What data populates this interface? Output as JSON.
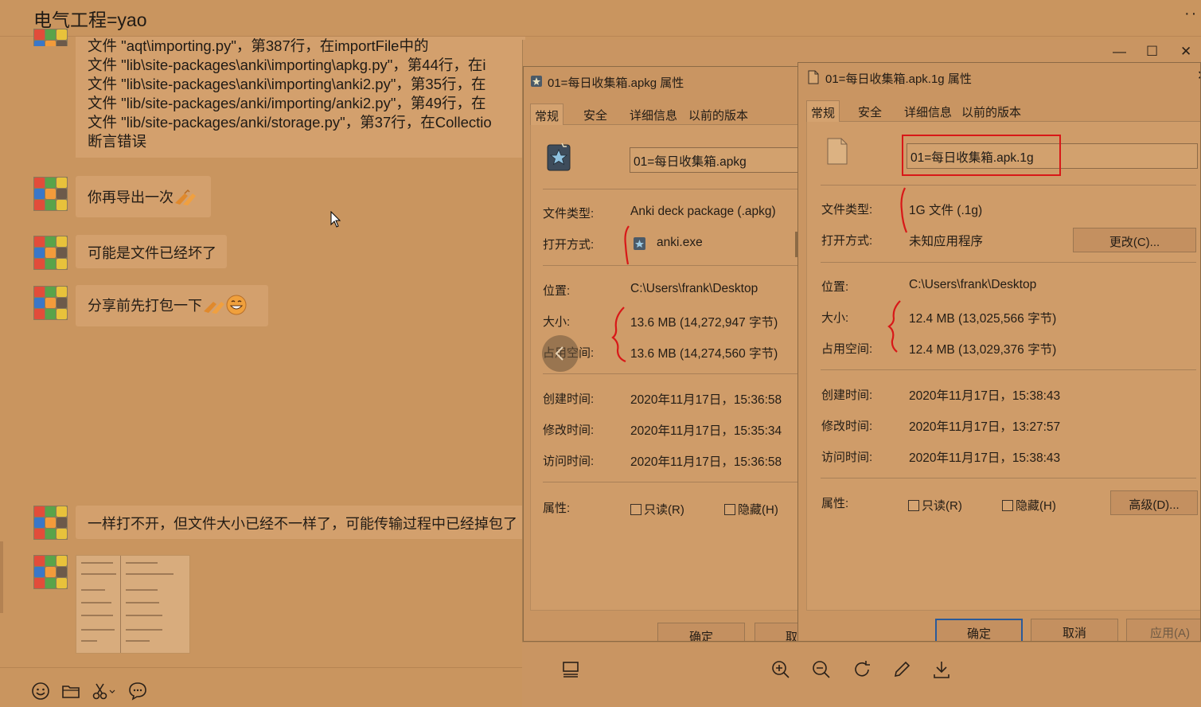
{
  "chat": {
    "title": "电气工程=yao",
    "more_icon": "more-dots-icon",
    "error_lines": [
      "  文件 \"aqt\\importing.py\"，第387行，在importFile中的",
      "  文件 \"lib\\site-packages\\anki\\importing\\apkg.py\"，第44行，在i",
      "  文件 \"lib\\site-packages\\anki\\importing\\anki2.py\"，第35行，在",
      "  文件 \"lib/site-packages/anki/importing/anki2.py\"，第49行，在",
      "  文件 \"lib/site-packages/anki/storage.py\"，第37行，在Collectio",
      "断言错误"
    ],
    "messages": [
      {
        "text": "你再导出一次",
        "emoji": "hand-emoji"
      },
      {
        "text": "可能是文件已经坏了"
      },
      {
        "text": "分享前先打包一下",
        "emoji": "hand-emoji",
        "emoji2": "grin-emoji"
      },
      {
        "text": "一样打不开，但文件大小已经不一样了，可能传输过程中已经掉包了"
      }
    ],
    "toolbar_icons": [
      "emoji-icon",
      "folder-icon",
      "scissors-icon",
      "chat-bubble-icon"
    ]
  },
  "dialog1": {
    "title": "01=每日收集箱.apkg 属性",
    "tabs": [
      "常规",
      "安全",
      "详细信息",
      "以前的版本"
    ],
    "filename": "01=每日收集箱.apkg",
    "labels": {
      "type": "文件类型:",
      "open_with": "打开方式:",
      "location": "位置:",
      "size": "大小:",
      "size_on_disk": "占用空间:",
      "created": "创建时间:",
      "modified": "修改时间:",
      "accessed": "访问时间:",
      "attributes": "属性:"
    },
    "values": {
      "type": "Anki deck package (.apkg)",
      "open_with": "anki.exe",
      "location": "C:\\Users\\frank\\Desktop",
      "size": "13.6 MB (14,272,947 字节)",
      "size_on_disk": "13.6 MB (14,274,560 字节)",
      "created": "2020年11月17日，15:36:58",
      "modified": "2020年11月17日，15:35:34",
      "accessed": "2020年11月17日，15:36:58"
    },
    "readonly": "只读(R)",
    "hidden": "隐藏(H)",
    "ok": "确定",
    "cancel": "取"
  },
  "dialog2": {
    "title": "01=每日收集箱.apk.1g 属性",
    "tabs": [
      "常规",
      "安全",
      "详细信息",
      "以前的版本"
    ],
    "filename": "01=每日收集箱.apk.1g",
    "labels": {
      "type": "文件类型:",
      "open_with": "打开方式:",
      "location": "位置:",
      "size": "大小:",
      "size_on_disk": "占用空间:",
      "created": "创建时间:",
      "modified": "修改时间:",
      "accessed": "访问时间:",
      "attributes": "属性:"
    },
    "values": {
      "type": "1G 文件 (.1g)",
      "open_with": "未知应用程序",
      "location": "C:\\Users\\frank\\Desktop",
      "size": "12.4 MB (13,025,566 字节)",
      "size_on_disk": "12.4 MB (13,029,376 字节)",
      "created": "2020年11月17日，15:38:43",
      "modified": "2020年11月17日，13:27:57",
      "accessed": "2020年11月17日，15:38:43"
    },
    "change": "更改(C)...",
    "readonly": "只读(R)",
    "hidden": "隐藏(H)",
    "advanced": "高级(D)...",
    "ok": "确定",
    "cancel": "取消",
    "apply": "应用(A)"
  },
  "viewer": {
    "window_controls": [
      "minimize-icon",
      "maximize-icon",
      "close-icon"
    ],
    "tools": [
      "toggle-panel-icon",
      "zoom-in-icon",
      "zoom-out-icon",
      "rotate-icon",
      "edit-icon",
      "download-icon"
    ]
  },
  "colors": {
    "background": "#c9955f",
    "bubble": "#d3a06d",
    "annotation_red": "#d81818",
    "focus_blue": "#2b5a99"
  }
}
